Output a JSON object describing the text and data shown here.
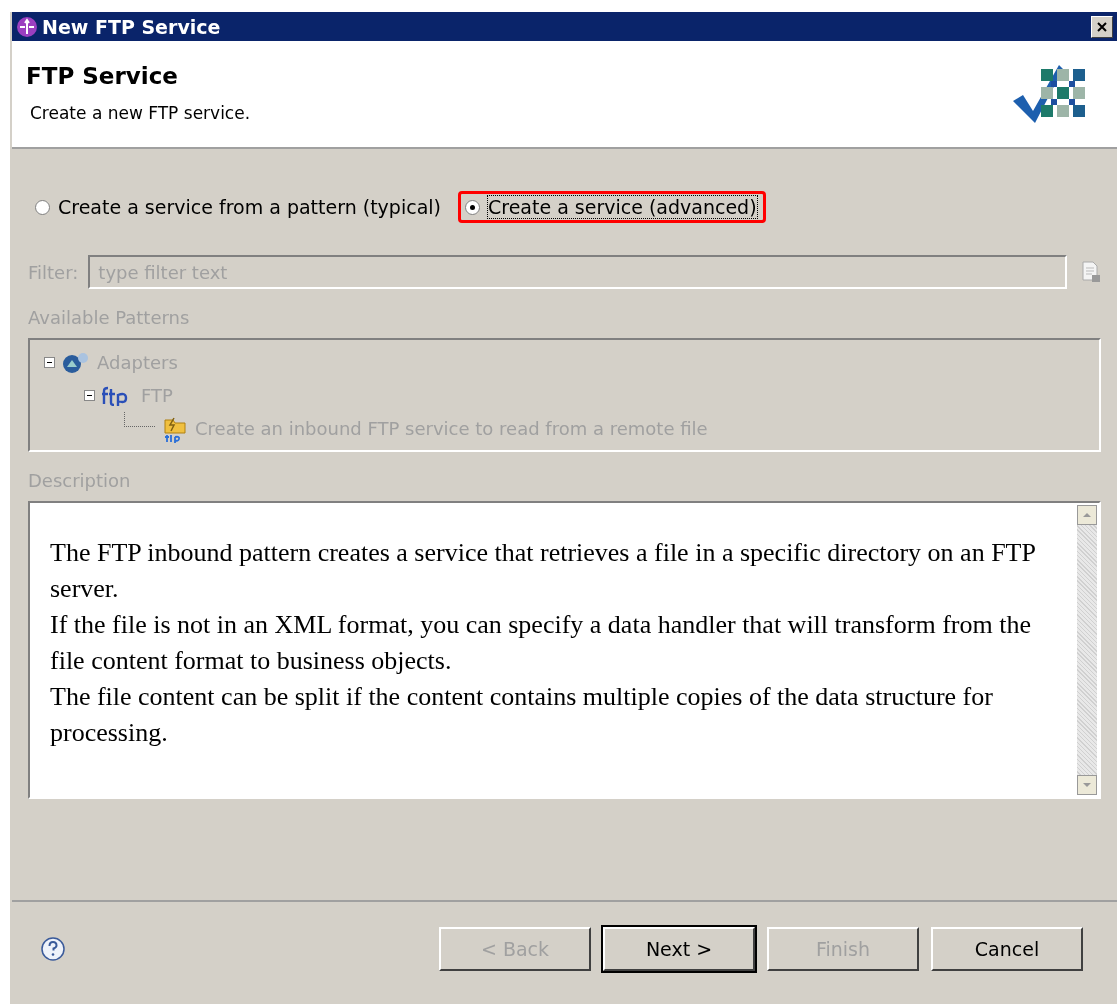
{
  "window": {
    "title": "New FTP Service"
  },
  "header": {
    "title": "FTP Service",
    "subtitle": "Create a new FTP service."
  },
  "options": [
    {
      "label": "Create a service from a pattern (typical)",
      "selected": false,
      "highlighted": false
    },
    {
      "label": "Create a service (advanced)",
      "selected": true,
      "highlighted": true
    }
  ],
  "filter": {
    "label": "Filter:",
    "placeholder": "type filter text",
    "disabled": true
  },
  "patterns": {
    "label": "Available Patterns",
    "disabled": true,
    "items": [
      {
        "kind": "adapters",
        "label": "Adapters",
        "expanded": true,
        "children": [
          {
            "kind": "ftp",
            "label": "FTP",
            "expanded": true,
            "children": [
              {
                "kind": "service",
                "label": "Create an inbound FTP service to read from a remote file"
              }
            ]
          }
        ]
      }
    ]
  },
  "description": {
    "label": "Description",
    "paragraphs": [
      "The FTP inbound pattern creates a service that retrieves a file in a specific directory on an FTP server.",
      "If the file is not in an XML format, you can specify a data handler that will transform from the file content format to business objects.",
      "The file content can be split if the content contains multiple copies of the data structure for processing."
    ]
  },
  "buttons": [
    {
      "label": "< Back",
      "disabled": true,
      "default": false
    },
    {
      "label": "Next >",
      "disabled": false,
      "default": true
    },
    {
      "label": "Finish",
      "disabled": true,
      "default": false
    },
    {
      "label": "Cancel",
      "disabled": false,
      "default": false
    }
  ]
}
